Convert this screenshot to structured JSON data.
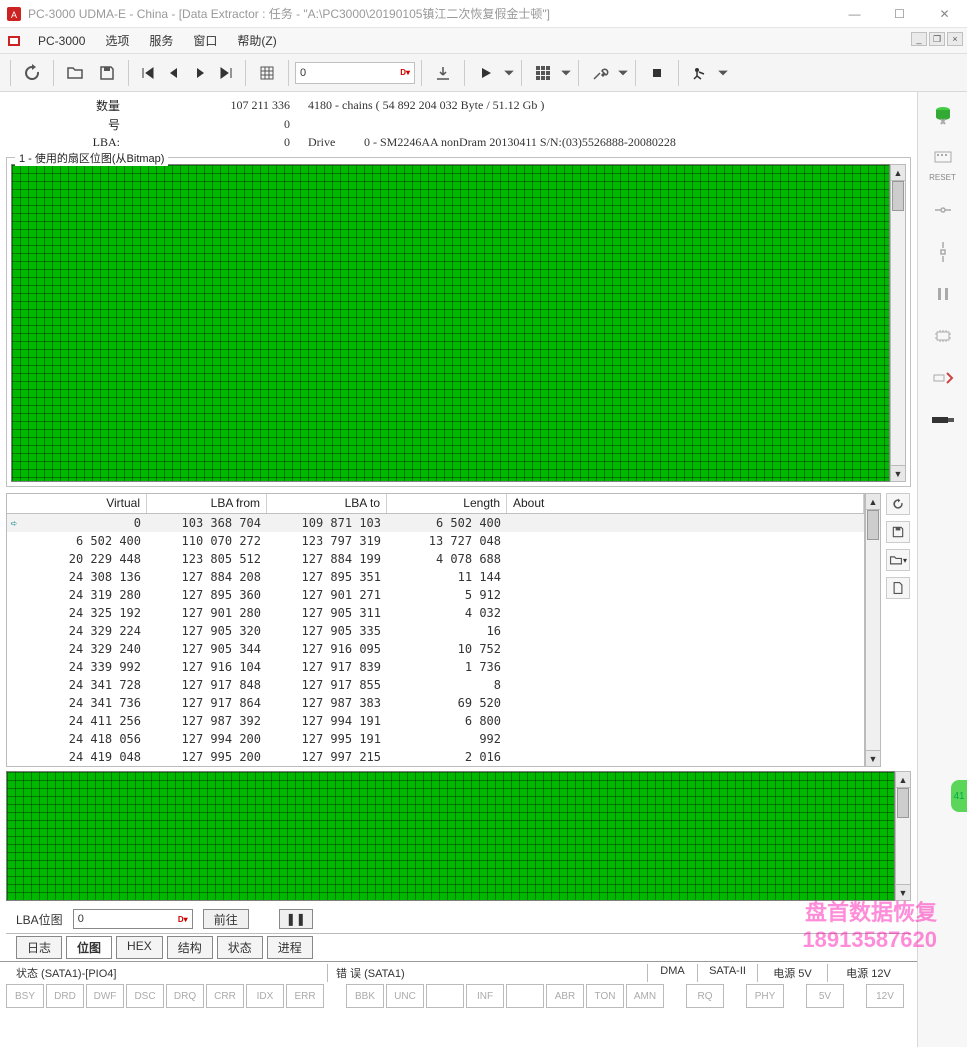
{
  "window": {
    "title": "PC-3000 UDMA-E - China - [Data Extractor : 任务 - \"A:\\PC3000\\20190105镇江二次恢复假金士顿\"]"
  },
  "menu": {
    "brand": "PC-3000",
    "items": [
      "选项",
      "服务",
      "窗口",
      "帮助(Z)"
    ]
  },
  "toolbar": {
    "address_value": "0"
  },
  "info": {
    "qty_label": "数量",
    "qty_value": "107 211 336",
    "chains_text": "4180 - chains  ( 54 892 204 032 Byte /  51.12 Gb )",
    "num_label": "号",
    "num_value": "0",
    "lba_label": "LBA:",
    "lba_value": "0",
    "drive_label": "Drive",
    "drive_value": "0 - SM2246AA nonDram 20130411 S/N:(03)5526888-20080228"
  },
  "bitmap_group_title": "1 - 使用的扇区位图(从Bitmap)",
  "right_tools": {
    "reset_label": "RESET"
  },
  "table": {
    "headers": {
      "virtual": "Virtual",
      "from": "LBA from",
      "to": "LBA to",
      "length": "Length",
      "about": "About"
    },
    "rows": [
      {
        "virtual": "0",
        "from": "103 368 704",
        "to": "109 871 103",
        "length": "6 502 400",
        "selected": true,
        "arrow": true
      },
      {
        "virtual": "6 502 400",
        "from": "110 070 272",
        "to": "123 797 319",
        "length": "13 727 048"
      },
      {
        "virtual": "20 229 448",
        "from": "123 805 512",
        "to": "127 884 199",
        "length": "4 078 688"
      },
      {
        "virtual": "24 308 136",
        "from": "127 884 208",
        "to": "127 895 351",
        "length": "11 144"
      },
      {
        "virtual": "24 319 280",
        "from": "127 895 360",
        "to": "127 901 271",
        "length": "5 912"
      },
      {
        "virtual": "24 325 192",
        "from": "127 901 280",
        "to": "127 905 311",
        "length": "4 032"
      },
      {
        "virtual": "24 329 224",
        "from": "127 905 320",
        "to": "127 905 335",
        "length": "16"
      },
      {
        "virtual": "24 329 240",
        "from": "127 905 344",
        "to": "127 916 095",
        "length": "10 752"
      },
      {
        "virtual": "24 339 992",
        "from": "127 916 104",
        "to": "127 917 839",
        "length": "1 736"
      },
      {
        "virtual": "24 341 728",
        "from": "127 917 848",
        "to": "127 917 855",
        "length": "8"
      },
      {
        "virtual": "24 341 736",
        "from": "127 917 864",
        "to": "127 987 383",
        "length": "69 520"
      },
      {
        "virtual": "24 411 256",
        "from": "127 987 392",
        "to": "127 994 191",
        "length": "6 800"
      },
      {
        "virtual": "24 418 056",
        "from": "127 994 200",
        "to": "127 995 191",
        "length": "992"
      },
      {
        "virtual": "24 419 048",
        "from": "127 995 200",
        "to": "127 997 215",
        "length": "2 016"
      }
    ]
  },
  "goto": {
    "label": "LBA位图",
    "value": "0",
    "go_btn": "前往"
  },
  "tabs": [
    "日志",
    "位图",
    "HEX",
    "结构",
    "状态",
    "进程"
  ],
  "active_tab": 1,
  "status": {
    "state_label": "状态 (SATA1)-[PIO4]",
    "err_label": "错 误 (SATA1)",
    "dma_label": "DMA",
    "sata2_label": "SATA-II",
    "p5v_label": "电源 5V",
    "p12v_label": "电源 12V",
    "lights1": [
      "BSY",
      "DRD",
      "DWF",
      "DSC",
      "DRQ",
      "CRR",
      "IDX",
      "ERR"
    ],
    "lights2": [
      "BBK",
      "UNC",
      "",
      "INF",
      "",
      "ABR",
      "TON",
      "AMN"
    ],
    "lights3": [
      "RQ"
    ],
    "lights4": [
      "PHY"
    ],
    "lights5": [
      "5V"
    ],
    "lights6": [
      "12V"
    ]
  },
  "watermark": {
    "line1": "盘首数据恢复",
    "line2": "18913587620"
  },
  "knob": "41"
}
